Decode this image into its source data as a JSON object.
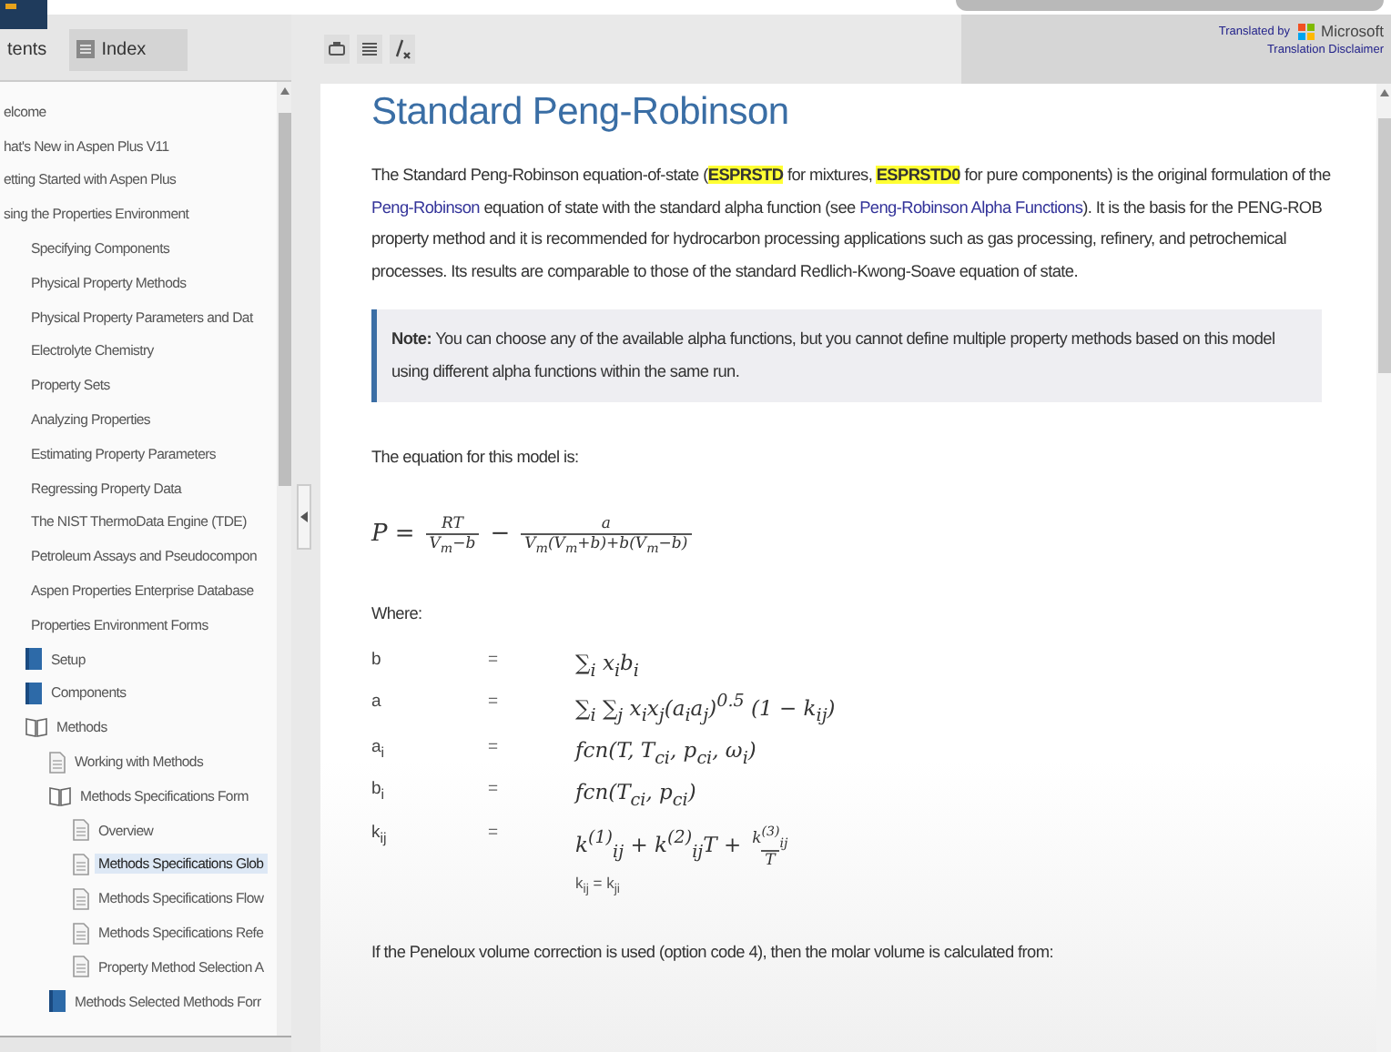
{
  "tabs": [
    {
      "label": "tents",
      "selected": true
    },
    {
      "label": "Index",
      "selected": false
    }
  ],
  "tree": [
    {
      "label": "elcome",
      "selected": false
    },
    {
      "label": "hat's New in Aspen Plus V11",
      "selected": false
    },
    {
      "label": "etting Started with Aspen Plus",
      "selected": false
    },
    {
      "label": "sing the Properties Environment",
      "selected": false,
      "children": [
        {
          "label": "Specifying Components",
          "selected": false
        },
        {
          "label": "Physical Property Methods",
          "selected": false
        },
        {
          "label": "Physical Property Parameters and Dat",
          "selected": false
        },
        {
          "label": "Electrolyte Chemistry",
          "selected": false
        },
        {
          "label": "Property Sets",
          "selected": false
        },
        {
          "label": "Analyzing Properties",
          "selected": false
        },
        {
          "label": "Estimating Property Parameters",
          "selected": false
        },
        {
          "label": "Regressing Property Data",
          "selected": false
        },
        {
          "label": "The NIST ThermoData Engine (TDE)",
          "selected": false
        },
        {
          "label": "Petroleum Assays and Pseudocompon",
          "selected": false
        },
        {
          "label": "Aspen Properties Enterprise Database",
          "selected": false
        },
        {
          "label": "Properties Environment Forms",
          "selected": false,
          "children": [
            {
              "label": "Setup",
              "kind": "book",
              "selected": false
            },
            {
              "label": "Components",
              "kind": "book",
              "selected": false
            },
            {
              "label": "Methods",
              "kind": "open-book",
              "selected": false,
              "children": [
                {
                  "label": "Working with Methods",
                  "kind": "page",
                  "selected": false
                },
                {
                  "label": "Methods Specifications Form",
                  "kind": "open-book",
                  "selected": false,
                  "children": [
                    {
                      "label": "Overview",
                      "kind": "page",
                      "selected": false
                    },
                    {
                      "label": "Methods Specifications Glob",
                      "kind": "page",
                      "selected": true
                    },
                    {
                      "label": "Methods Specifications Flow",
                      "kind": "page",
                      "selected": false
                    },
                    {
                      "label": "Methods Specifications Refe",
                      "kind": "page",
                      "selected": false
                    },
                    {
                      "label": "Property Method Selection A",
                      "kind": "page",
                      "selected": false
                    }
                  ]
                },
                {
                  "label": "Methods Selected Methods Forr",
                  "kind": "book",
                  "selected": false
                }
              ]
            }
          ]
        }
      ]
    }
  ],
  "translation": {
    "translated_by": "Translated by",
    "brand": "Microsoft",
    "disclaimer": "Translation Disclaimer"
  },
  "article": {
    "title": "Standard Peng-Robinson",
    "intro": [
      {
        "kind": "plain",
        "text": "The Standard Peng-Robinson equation-of-state ("
      },
      {
        "kind": "highlight",
        "text": "ESPRSTD"
      },
      {
        "kind": "plain",
        "text": " for mixtures, "
      },
      {
        "kind": "highlight",
        "text": "ESPRSTD0"
      },
      {
        "kind": "plain",
        "text": " for pure components) is the original formulation of the "
      },
      {
        "kind": "link",
        "text": "Peng-Robinson"
      },
      {
        "kind": "plain",
        "text": " equation of state with the standard alpha function (see "
      },
      {
        "kind": "link",
        "text": "Peng-Robinson Alpha Functions"
      },
      {
        "kind": "plain",
        "text": "). It is the basis for the PENG-ROB property method and it is recommended for hydrocarbon processing applications such as gas processing, refinery, and petrochemical processes. Its results are comparable to those of the standard Redlich-Kwong-Soave equation of state."
      }
    ],
    "note": "**Note:** You can choose any of the available alpha functions, but you cannot define multiple property methods based on this model using different alpha functions within the same run.",
    "equation_intro": "The equation for this model is:",
    "equation": [
      {
        "text": "P ="
      },
      {
        "numerator": "RT",
        "denominator": "V$_{m}$−b"
      },
      {
        "text": "−"
      },
      {
        "numerator": "a",
        "denominator": "V$_{m}$(V$_{m}$+b)+b(V$_{m}$−b)"
      }
    ],
    "where": "Where:",
    "definitions": [
      {
        "symbol": "b",
        "equals": "=",
        "formula": [
          {
            "text": "∑$_{i}$ x$_{i}$b$_{i}$"
          }
        ]
      },
      {
        "symbol": "a",
        "equals": "=",
        "formula": [
          {
            "text": "∑$_{i}$ ∑$_{j}$ x$_{i}$x$_{j}$(a$_{i}$a$_{j}$)$^{0.5}$ (1 − k$_{ij}$)"
          }
        ]
      },
      {
        "symbol": "a$_{i}$",
        "equals": "=",
        "formula": [
          {
            "text": "fcn(T, T$_{ci}$, p$_{ci}$, ω$_{i}$)"
          }
        ]
      },
      {
        "symbol": "b$_{i}$",
        "equals": "=",
        "formula": [
          {
            "text": "fcn(T$_{ci}$, p$_{ci}$)"
          }
        ]
      },
      {
        "symbol": "k$_{ij}$",
        "equals": "=",
        "formula": [
          {
            "text": "k$^{(1)}$$_{ij}$ + k$^{(2)}$$_{ij}$T +"
          },
          {
            "numerator": "k$^{(3)}$$_{ij}$",
            "denominator": "T"
          }
        ],
        "note": "k$_{ij}$ = k$_{ji}$"
      }
    ],
    "closing": "If the Peneloux volume correction is used (option code 4), then the molar volume is calculated from:"
  }
}
